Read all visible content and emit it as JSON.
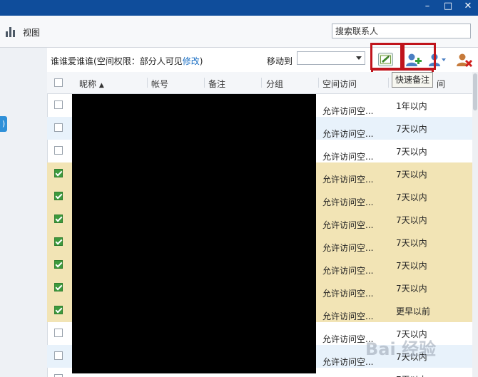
{
  "window": {
    "minimize_glyph": "–",
    "maximize_glyph": "□",
    "close_glyph": "✕"
  },
  "toolbar": {
    "view_label": "视图",
    "search_value": "搜索联系人"
  },
  "left_panel": {
    "tab_label": ")"
  },
  "info": {
    "group_name": "谁谁爱谁谁",
    "permission_text": "(空间权限：部分人可见",
    "edit_link": "修改",
    "close_paren": ")"
  },
  "move_to": {
    "label": "移动到",
    "value": ""
  },
  "tooltip": {
    "text": "快速备注"
  },
  "columns": {
    "nickname": "昵称",
    "sort_arrow": "▲",
    "account": "帐号",
    "note": "备注",
    "group": "分组",
    "space_access": "空间访问",
    "last_visit_tail": "间"
  },
  "rows": [
    {
      "checked": false,
      "highlight": false,
      "access": "允许访问空...",
      "time": "1年以内"
    },
    {
      "checked": false,
      "highlight": true,
      "access": "允许访问空...",
      "time": "7天以内"
    },
    {
      "checked": false,
      "highlight": false,
      "access": "允许访问空...",
      "time": "7天以内"
    },
    {
      "checked": true,
      "highlight": false,
      "access": "允许访问空...",
      "time": "7天以内"
    },
    {
      "checked": true,
      "highlight": false,
      "access": "允许访问空...",
      "time": "7天以内"
    },
    {
      "checked": true,
      "highlight": false,
      "access": "允许访问空...",
      "time": "7天以内"
    },
    {
      "checked": true,
      "highlight": false,
      "access": "允许访问空...",
      "time": "7天以内"
    },
    {
      "checked": true,
      "highlight": false,
      "access": "允许访问空...",
      "time": "7天以内"
    },
    {
      "checked": true,
      "highlight": false,
      "access": "允许访问空...",
      "time": "7天以内"
    },
    {
      "checked": true,
      "highlight": false,
      "access": "允许访问空...",
      "time": "更早以前"
    },
    {
      "checked": false,
      "highlight": false,
      "access": "允许访问空...",
      "time": "7天以内"
    },
    {
      "checked": false,
      "highlight": true,
      "access": "允许访问空...",
      "time": "7天以内"
    },
    {
      "checked": false,
      "highlight": false,
      "access": "",
      "time": "7天以内"
    }
  ],
  "watermark": {
    "text": "Bai 经验"
  },
  "colors": {
    "titlebar": "#0f4d9b",
    "checked_row": "#f2e4b5",
    "hover_row": "#e8f2fb",
    "link": "#1a6fc4",
    "highlight_box": "#c0141c",
    "checkbox_checked": "#3d9a3d"
  },
  "icons": [
    "bar-chart-icon",
    "quick-note-icon",
    "add-contact-icon",
    "contact-settings-icon",
    "delete-contact-icon",
    "sort-up-icon",
    "dropdown-arrow-icon"
  ]
}
